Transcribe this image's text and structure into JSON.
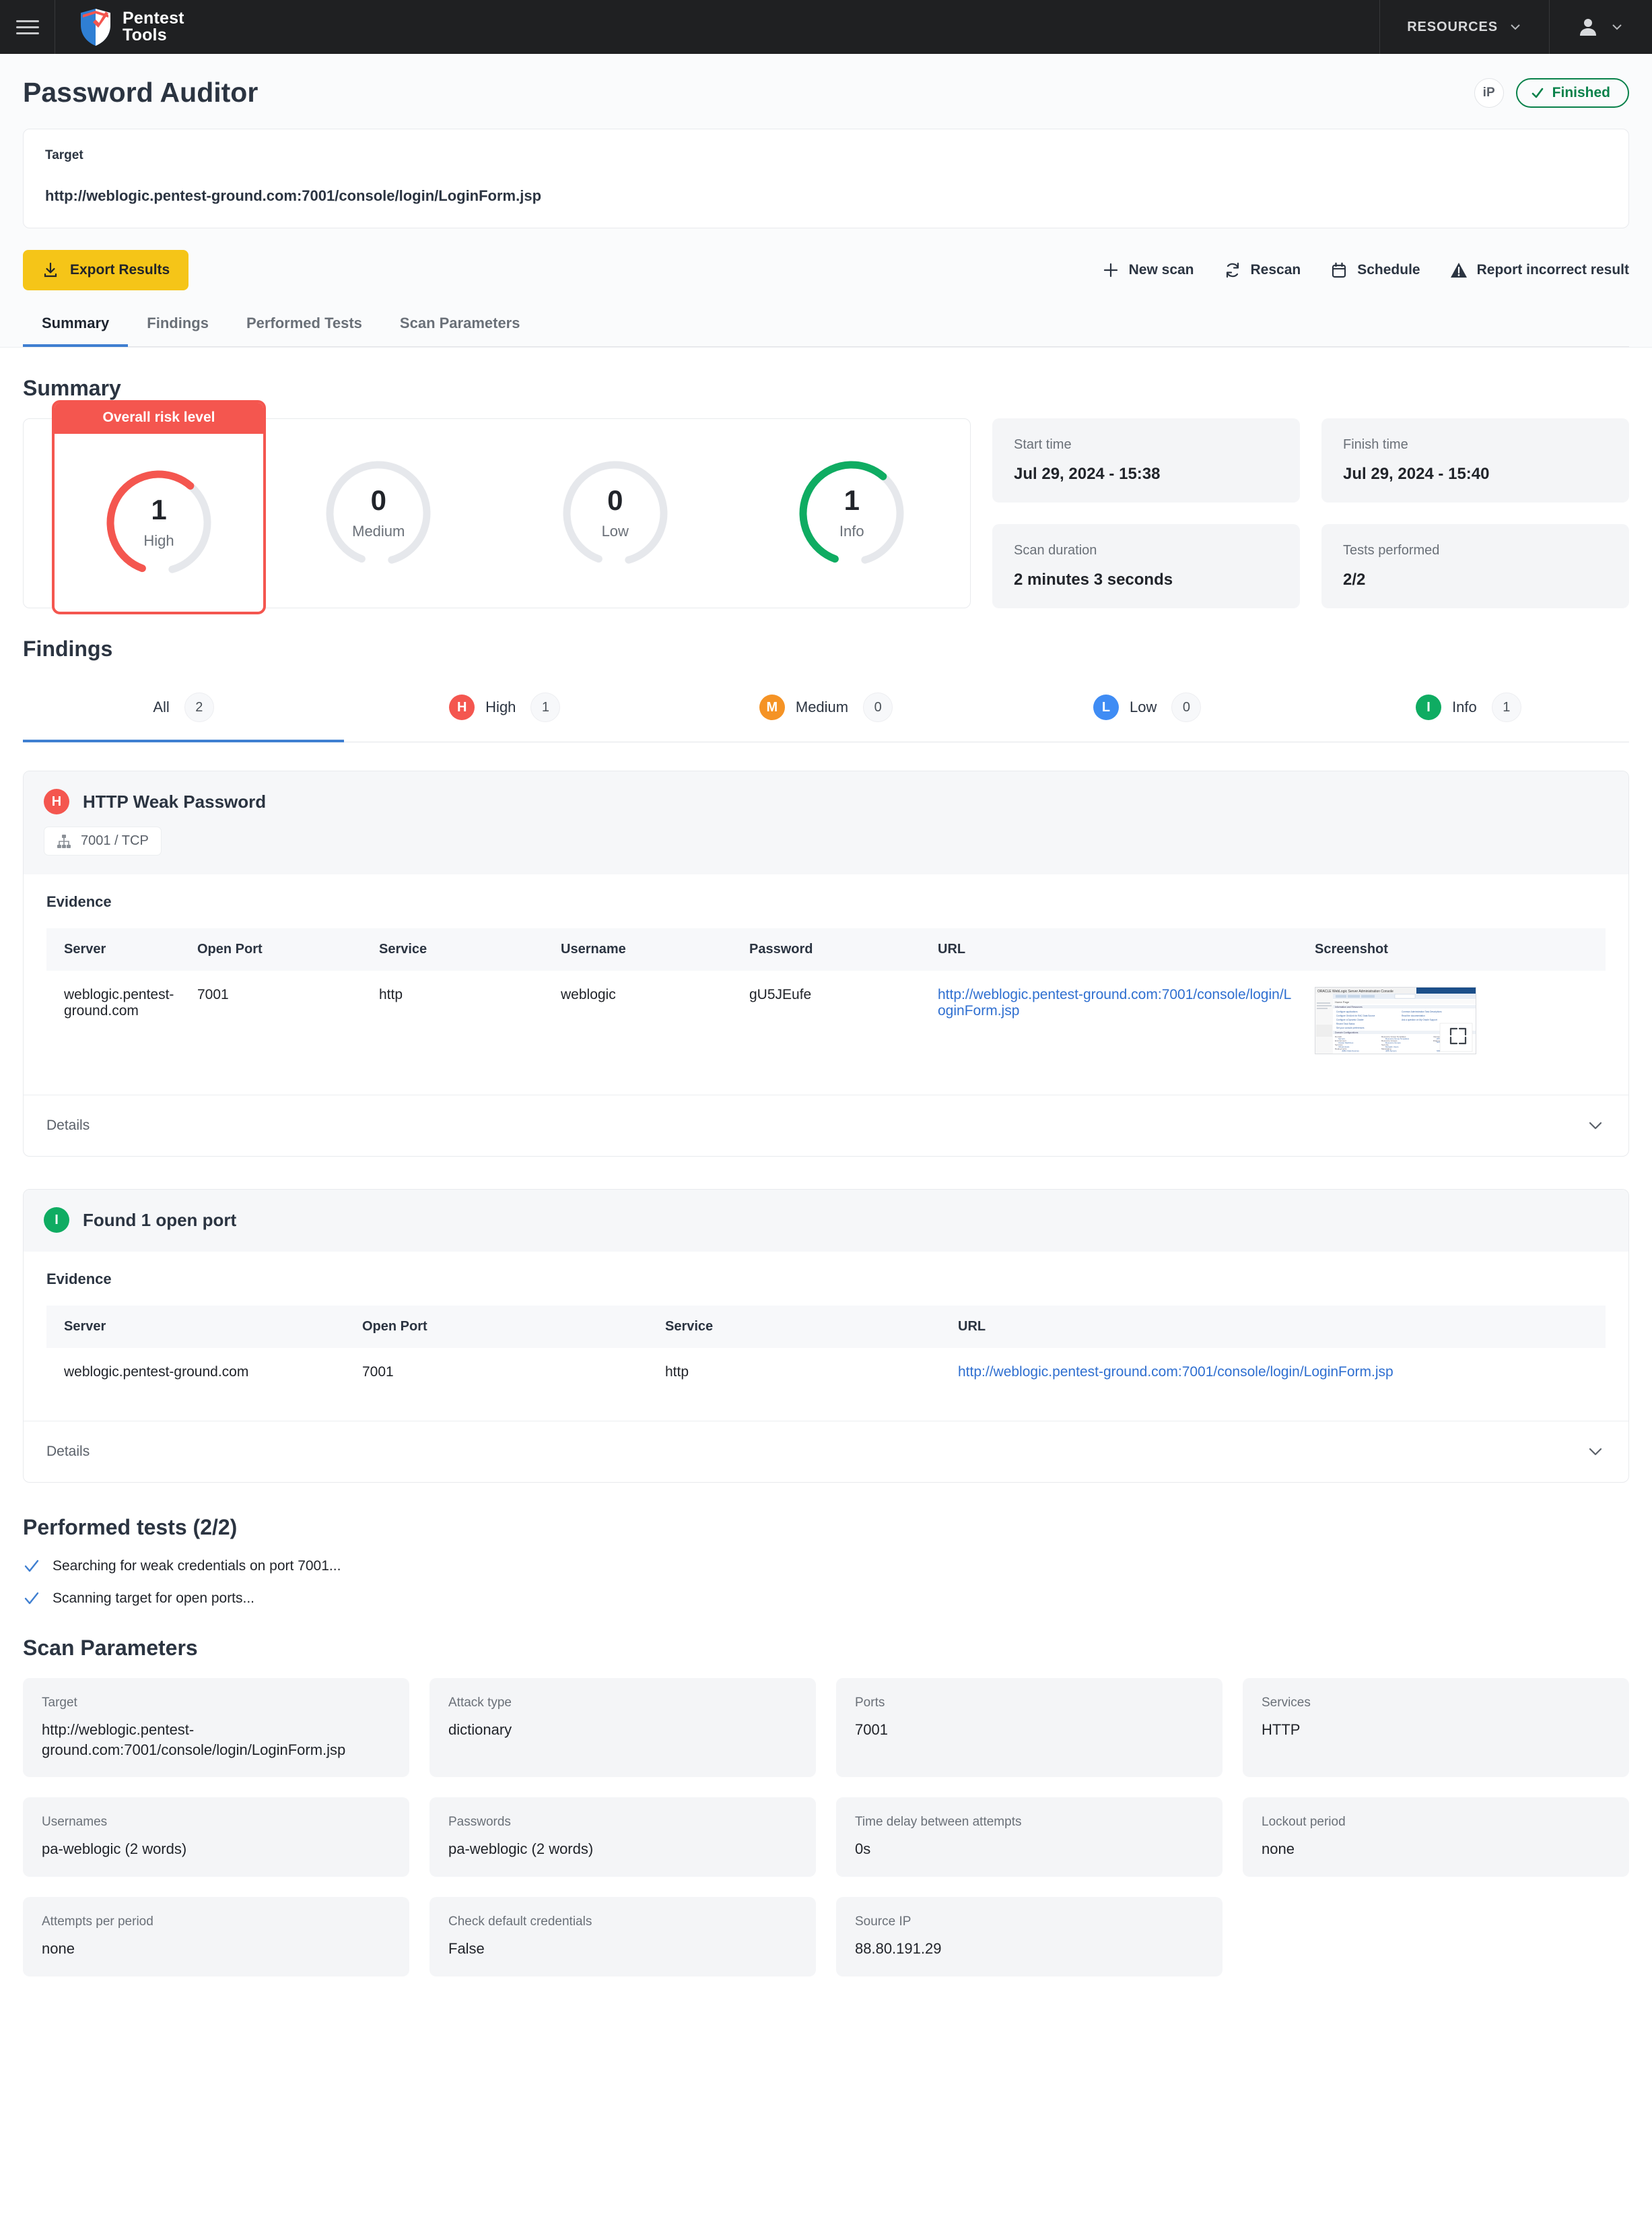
{
  "nav": {
    "brand_line1": "Pentest",
    "brand_line2": "Tools",
    "resources_label": "RESOURCES",
    "menu_icon": "hamburger-icon",
    "user_icon": "user-avatar-icon"
  },
  "header": {
    "title": "Password Auditor",
    "ip_chip": "iP",
    "status": "Finished"
  },
  "target": {
    "label": "Target",
    "value": "http://weblogic.pentest-ground.com:7001/console/login/LoginForm.jsp"
  },
  "toolbar": {
    "export_label": "Export Results",
    "actions": [
      {
        "label": "New scan",
        "icon": "plus-icon"
      },
      {
        "label": "Rescan",
        "icon": "refresh-icon"
      },
      {
        "label": "Schedule",
        "icon": "calendar-icon"
      },
      {
        "label": "Report incorrect result",
        "icon": "warning-icon"
      }
    ]
  },
  "tabs": [
    {
      "label": "Summary",
      "active": true
    },
    {
      "label": "Findings",
      "active": false
    },
    {
      "label": "Performed Tests",
      "active": false
    },
    {
      "label": "Scan Parameters",
      "active": false
    }
  ],
  "summary": {
    "heading": "Summary",
    "overall_risk_label": "Overall risk level",
    "gauges": [
      {
        "value": "1",
        "label": "High",
        "color": "#f4564f",
        "percent": 62
      },
      {
        "value": "0",
        "label": "Medium",
        "color": "#f59325",
        "percent": 0
      },
      {
        "value": "0",
        "label": "Low",
        "color": "#3f8cf4",
        "percent": 0
      },
      {
        "value": "1",
        "label": "Info",
        "color": "#0fac62",
        "percent": 62
      }
    ],
    "info_cards": [
      {
        "label": "Start time",
        "value": "Jul 29, 2024 - 15:38"
      },
      {
        "label": "Finish time",
        "value": "Jul 29, 2024 - 15:40"
      },
      {
        "label": "Scan duration",
        "value": "2 minutes 3 seconds"
      },
      {
        "label": "Tests performed",
        "value": "2/2"
      }
    ]
  },
  "findings": {
    "heading": "Findings",
    "filters": [
      {
        "label": "All",
        "count": "2",
        "badge": null,
        "color": null,
        "active": true
      },
      {
        "label": "High",
        "count": "1",
        "badge": "H",
        "color": "#f4564f",
        "active": false
      },
      {
        "label": "Medium",
        "count": "0",
        "badge": "M",
        "color": "#f59325",
        "active": false
      },
      {
        "label": "Low",
        "count": "0",
        "badge": "L",
        "color": "#3f8cf4",
        "active": false
      },
      {
        "label": "Info",
        "count": "1",
        "badge": "I",
        "color": "#0fac62",
        "active": false
      }
    ],
    "items": [
      {
        "badge": "H",
        "badge_color": "#f4564f",
        "title": "HTTP Weak Password",
        "port_chip": "7001 / TCP",
        "evidence_label": "Evidence",
        "columns": [
          "Server",
          "Open Port",
          "Service",
          "Username",
          "Password",
          "URL",
          "Screenshot"
        ],
        "row": {
          "server": "weblogic.pentest-ground.com",
          "open_port": "7001",
          "service": "http",
          "username": "weblogic",
          "password": "gU5JEufe",
          "url": "http://weblogic.pentest-ground.com:7001/console/login/LoginForm.jsp",
          "screenshot": "weblogic-admin-console-thumbnail"
        },
        "details_label": "Details"
      },
      {
        "badge": "I",
        "badge_color": "#0fac62",
        "title": "Found 1 open port",
        "port_chip": null,
        "evidence_label": "Evidence",
        "columns": [
          "Server",
          "Open Port",
          "Service",
          "URL"
        ],
        "row": {
          "server": "weblogic.pentest-ground.com",
          "open_port": "7001",
          "service": "http",
          "url": "http://weblogic.pentest-ground.com:7001/console/login/LoginForm.jsp"
        },
        "details_label": "Details"
      }
    ]
  },
  "performed_tests": {
    "heading": "Performed tests (2/2)",
    "items": [
      "Searching for weak credentials on port 7001...",
      "Scanning target for open ports..."
    ]
  },
  "scan_parameters": {
    "heading": "Scan Parameters",
    "items": [
      {
        "label": "Target",
        "value": "http://weblogic.pentest-ground.com:7001/console/login/LoginForm.jsp"
      },
      {
        "label": "Attack type",
        "value": "dictionary"
      },
      {
        "label": "Ports",
        "value": "7001"
      },
      {
        "label": "Services",
        "value": "HTTP"
      },
      {
        "label": "Usernames",
        "value": "pa-weblogic (2 words)"
      },
      {
        "label": "Passwords",
        "value": "pa-weblogic (2 words)"
      },
      {
        "label": "Time delay between attempts",
        "value": "0s"
      },
      {
        "label": "Lockout period",
        "value": "none"
      },
      {
        "label": "Attempts per period",
        "value": "none"
      },
      {
        "label": "Check default credentials",
        "value": "False"
      },
      {
        "label": "Source IP",
        "value": "88.80.191.29"
      }
    ]
  },
  "colors": {
    "accent_blue": "#3f7fd1",
    "brand_yellow": "#f5c518",
    "high": "#f4564f",
    "medium": "#f59325",
    "low": "#3f8cf4",
    "info": "#0fac62",
    "finished_green": "#09814a"
  }
}
